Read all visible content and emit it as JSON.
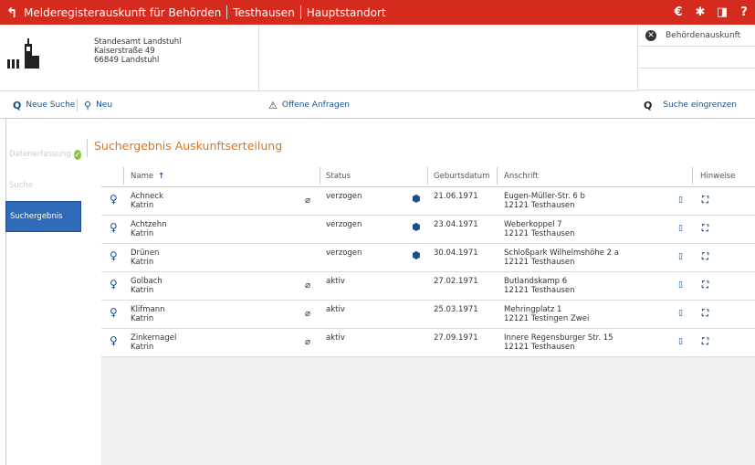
{
  "topbar": {
    "title_app": "Melderegisterauskunft für Behörden",
    "title_city": "Testhausen",
    "title_site": "Hauptstandort"
  },
  "header": {
    "office": "Standesamt Landstuhl",
    "street": "Kaiserstraße 49",
    "zip_city": "66849 Landstuhl",
    "right_label": "Behördenauskunft"
  },
  "actions": {
    "new_search": "Neue Suche",
    "new": "Neu",
    "open_requests": "Offene Anfragen",
    "narrow_search": "Suche eingrenzen"
  },
  "sidebar": {
    "items": [
      {
        "label": "Datenerfassung"
      },
      {
        "label": "Suche"
      },
      {
        "label": "Suchergebnis"
      }
    ]
  },
  "main": {
    "title": "Suchergebnis Auskunftserteilung",
    "columns": {
      "name": "Name",
      "status": "Status",
      "dob": "Geburtsdatum",
      "address": "Anschrift",
      "notes": "Hinweise"
    },
    "rows": [
      {
        "lastname": "Achneck",
        "firstname": "Katrin",
        "status": "verzogen",
        "dob": "21.06.1971",
        "street": "Eugen-Müller-Str. 6 b",
        "city": "12121 Testhausen"
      },
      {
        "lastname": "Achtzehn",
        "firstname": "Katrin",
        "status": "verzogen",
        "dob": "23.04.1971",
        "street": "Weberkoppel 7",
        "city": "12121 Testhausen"
      },
      {
        "lastname": "Drünen",
        "firstname": "Katrin",
        "status": "verzogen",
        "dob": "30.04.1971",
        "street": "Schloßpark Wilhelmshöhe 2 a",
        "city": "12121 Testhausen"
      },
      {
        "lastname": "Golbach",
        "firstname": "Katrin",
        "status": "aktiv",
        "dob": "27.02.1971",
        "street": "Butlandskamp 6",
        "city": "12121 Testhausen"
      },
      {
        "lastname": "Klifmann",
        "firstname": "Katrin",
        "status": "aktiv",
        "dob": "25.03.1971",
        "street": "Mehringplatz 1",
        "city": "12121 Testingen Zwei"
      },
      {
        "lastname": "Zinkernagel",
        "firstname": "Katrin",
        "status": "aktiv",
        "dob": "27.09.1971",
        "street": "Innere Regensburger Str. 15",
        "city": "12121 Testhausen"
      }
    ]
  }
}
